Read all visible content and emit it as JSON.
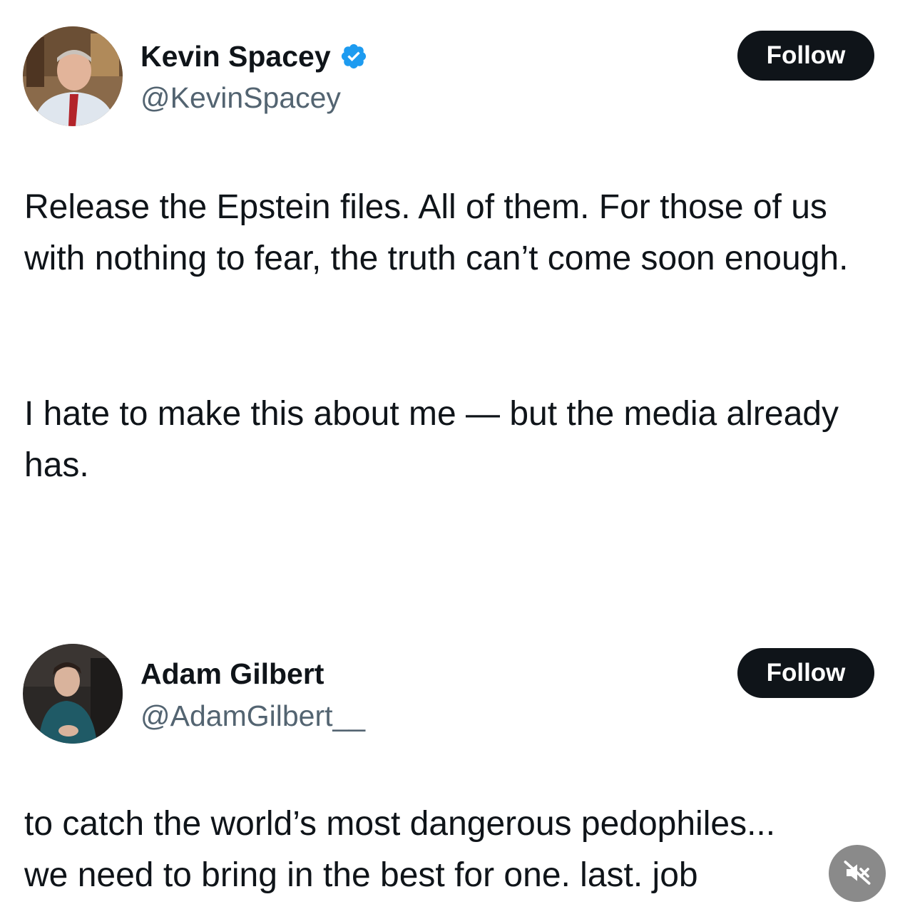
{
  "tweets": [
    {
      "display_name": "Kevin Spacey",
      "handle": "@KevinSpacey",
      "verified": true,
      "follow_label": "Follow",
      "text_paragraphs": [
        "Release the Epstein files. All of them. For those of us with nothing to fear, the truth can’t come soon enough.",
        "I hate to make this about me — but the media already has."
      ]
    },
    {
      "display_name": "Adam Gilbert",
      "handle": "@AdamGilbert__",
      "verified": false,
      "follow_label": "Follow",
      "text_paragraphs": [
        "to catch the world’s most dangerous pedophiles... we need to bring in the best for one. last. job"
      ]
    }
  ],
  "media_controls": {
    "mute_icon": "speaker-muted-icon"
  },
  "colors": {
    "follow_bg": "#0f1419",
    "verified_blue": "#1d9bf0",
    "handle_gray": "#536471"
  }
}
